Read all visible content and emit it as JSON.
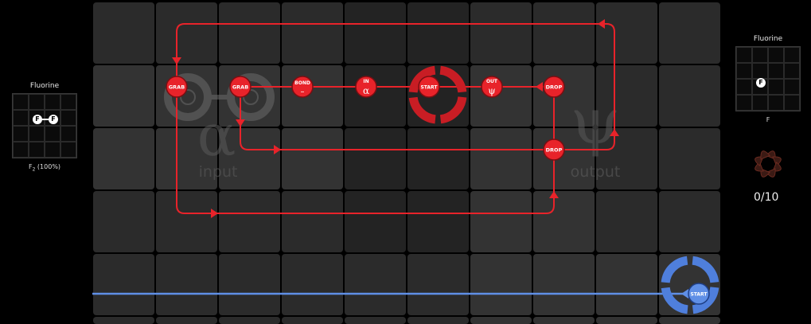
{
  "input_panel": {
    "title": "Fluorine",
    "atom_symbol": "F",
    "caption_main": "F",
    "caption_sub": "2",
    "caption_tail": " (100%)"
  },
  "output_panel": {
    "title": "Fluorine",
    "atom_symbol": "F",
    "caption": "F"
  },
  "progress": {
    "text": "0/10",
    "done": 0,
    "target": 10
  },
  "zones": {
    "input_label": "input",
    "input_symbol": "α",
    "output_label": "output",
    "output_symbol": "ψ"
  },
  "red_waldo": {
    "color": "#e8232a",
    "instructions": {
      "grab1": "GRAB",
      "grab2": "GRAB",
      "bond_label": "BOND",
      "bond_symbol": "–",
      "in_label": "IN",
      "in_symbol": "α",
      "start": "START",
      "out_label": "OUT",
      "out_symbol": "ψ",
      "drop1": "DROP",
      "drop2": "DROP"
    }
  },
  "blue_waldo": {
    "color": "#4f7fdc",
    "start": "START"
  },
  "pending_atom_symbol": "F",
  "colors": {
    "cell_dark": "#2b2b2b",
    "cell_mid": "#333333",
    "line_red": "#e8232a",
    "line_blue": "#5f8fe6"
  }
}
